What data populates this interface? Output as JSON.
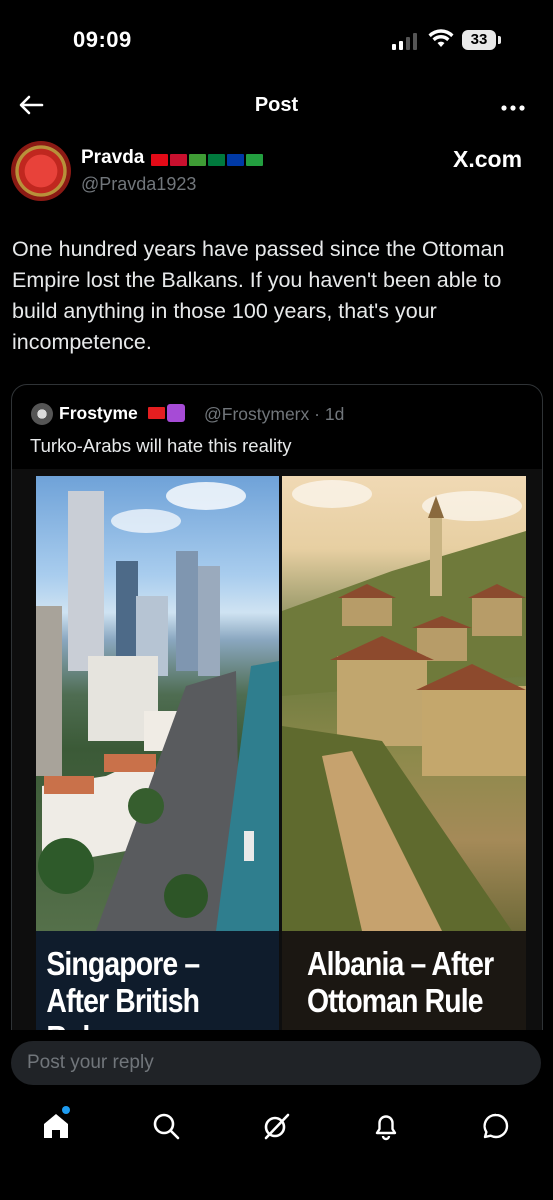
{
  "status_bar": {
    "time": "09:09",
    "battery": "33"
  },
  "nav": {
    "title": "Post",
    "back_icon": "arrow-left-icon",
    "more_icon": "more-horizontal-icon"
  },
  "post": {
    "author_name": "Pravda",
    "author_handle": "@Pravda1923",
    "author_flags": [
      "#e30a17",
      "#c8102e",
      "#3f9c35",
      "#007a3d",
      "#0039a6",
      "#239f40"
    ],
    "brand": "X.com",
    "text": "One hundred years have passed since the Ottoman Empire lost the Balkans. If you haven't been able to build anything in those 100 years, that's your incompetence."
  },
  "quote": {
    "author_name": "Frostyme",
    "author_handle": "@Frostymerx",
    "time": "· 1d",
    "text": "Turko-Arabs will hate this reality",
    "image": {
      "left_caption_line1": "Singapore –",
      "left_caption_line2": "After British Rule",
      "right_caption_line1": "Albania – After",
      "right_caption_line2": "Ottoman Rule"
    }
  },
  "reply": {
    "placeholder": "Post your reply"
  },
  "tabs": [
    {
      "name": "home",
      "icon": "home-icon"
    },
    {
      "name": "search",
      "icon": "search-icon"
    },
    {
      "name": "grok",
      "icon": "grok-icon"
    },
    {
      "name": "notifications",
      "icon": "bell-icon"
    },
    {
      "name": "messages",
      "icon": "chat-icon"
    }
  ],
  "colors": {
    "accent": "#1d9bf0",
    "muted": "#71767b",
    "border": "#2f3336"
  }
}
